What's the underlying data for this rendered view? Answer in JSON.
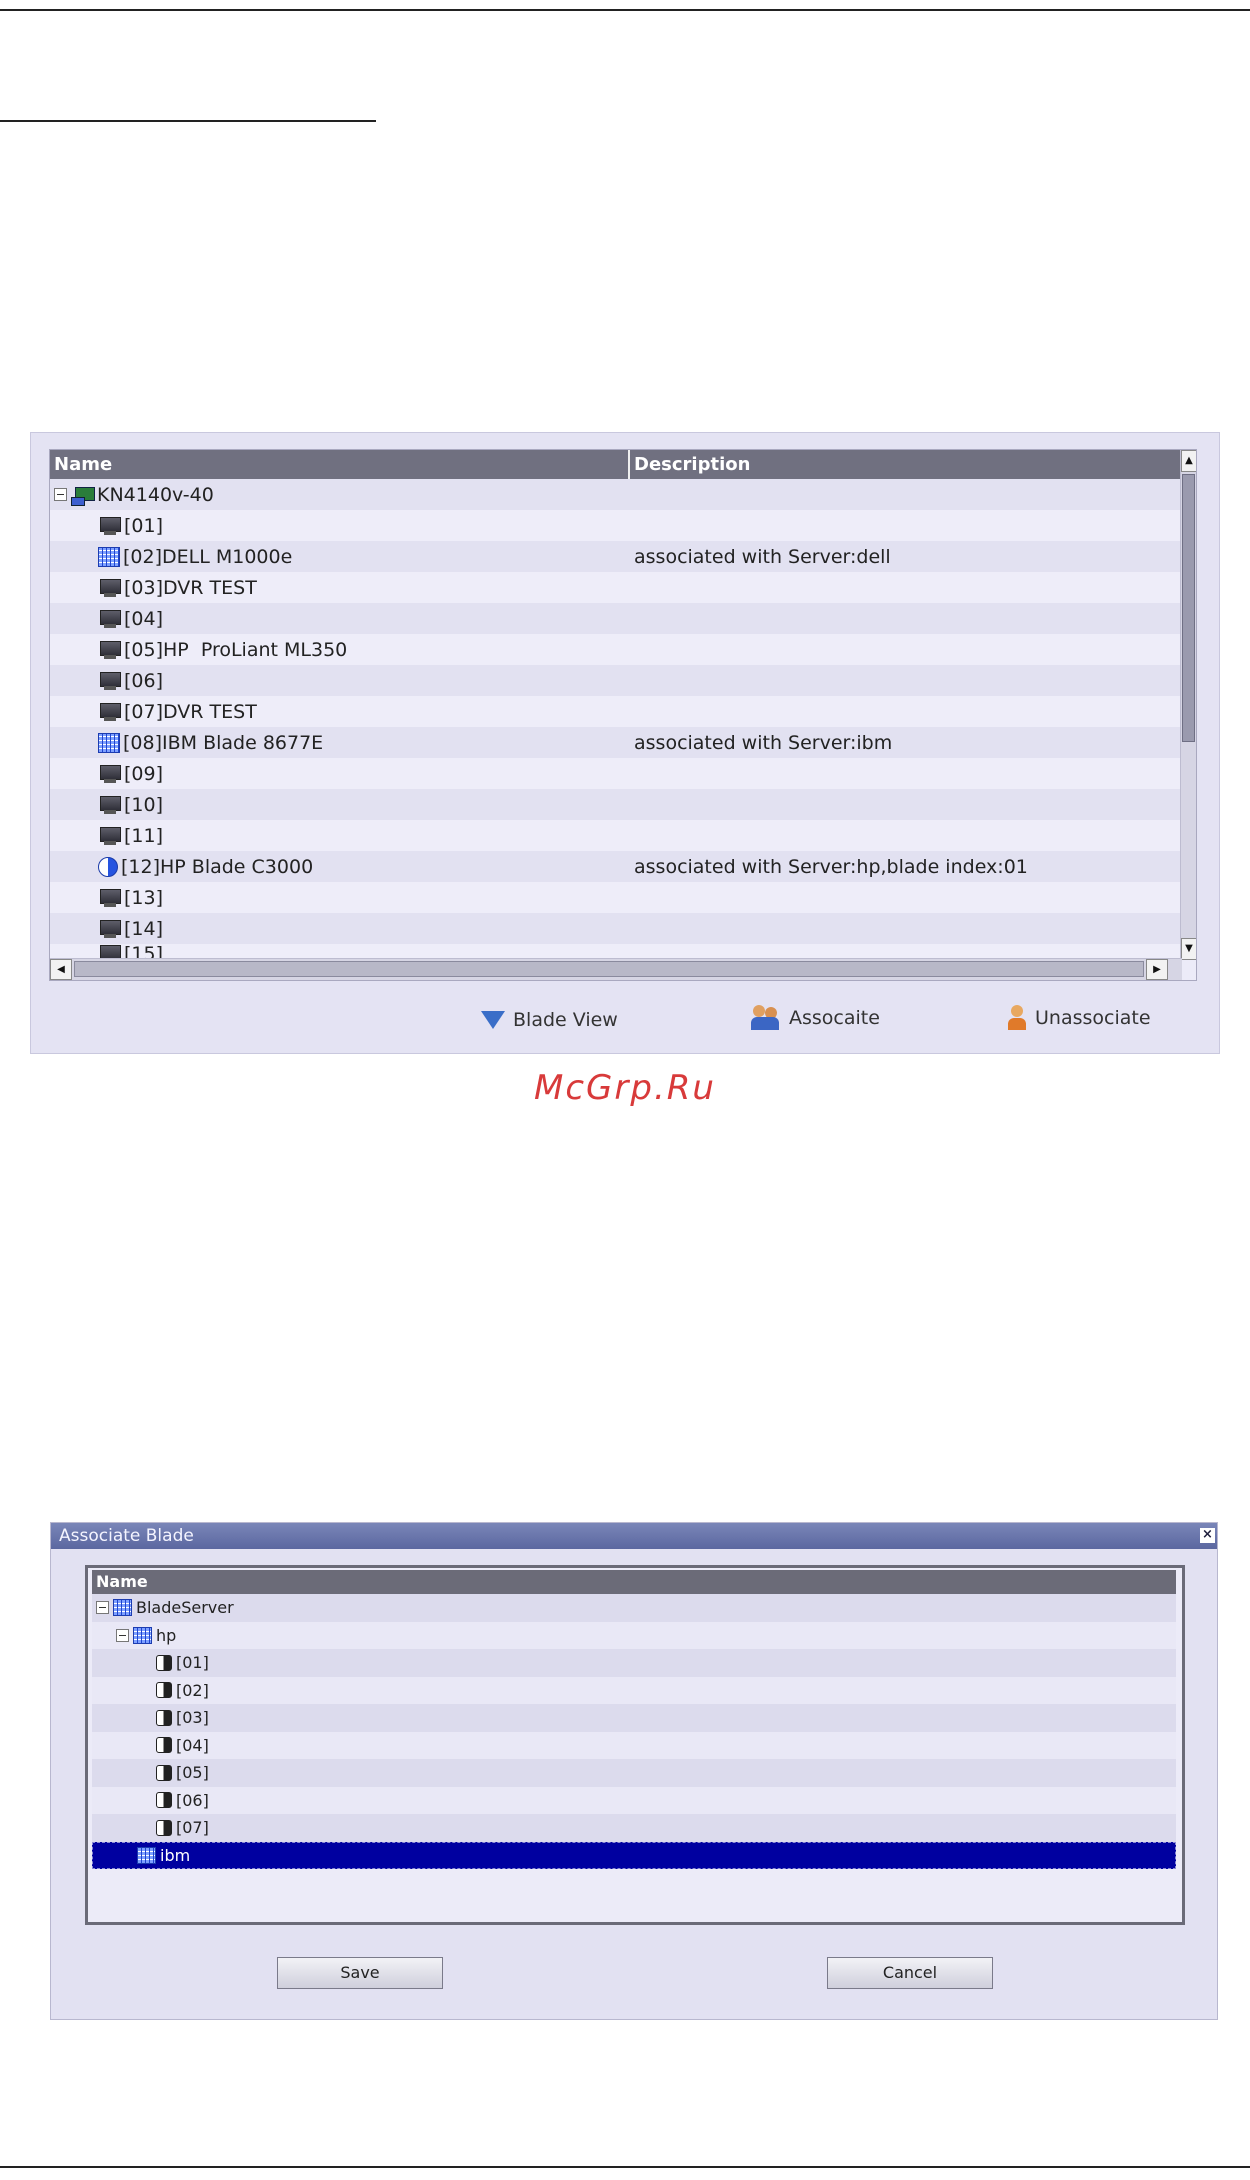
{
  "port_panel": {
    "columns": {
      "name": "Name",
      "description": "Description"
    },
    "root": {
      "label": "KN4140v-40"
    },
    "rows": [
      {
        "icon": "monitor-icon",
        "name": "[01]",
        "description": ""
      },
      {
        "icon": "blade-grid-icon",
        "name": "[02]DELL M1000e",
        "description": "associated with Server:dell"
      },
      {
        "icon": "monitor-icon",
        "name": "[03]DVR TEST",
        "description": ""
      },
      {
        "icon": "monitor-icon",
        "name": "[04]",
        "description": ""
      },
      {
        "icon": "monitor-icon",
        "name": "[05]HP  ProLiant ML350",
        "description": ""
      },
      {
        "icon": "monitor-icon",
        "name": "[06]",
        "description": ""
      },
      {
        "icon": "monitor-icon",
        "name": "[07]DVR TEST",
        "description": ""
      },
      {
        "icon": "blade-grid-icon",
        "name": "[08]IBM Blade 8677E",
        "description": "associated with Server:ibm"
      },
      {
        "icon": "monitor-icon",
        "name": "[09]",
        "description": ""
      },
      {
        "icon": "monitor-icon",
        "name": "[10]",
        "description": ""
      },
      {
        "icon": "monitor-icon",
        "name": "[11]",
        "description": ""
      },
      {
        "icon": "blade-half-icon",
        "name": "[12]HP Blade C3000",
        "description": "associated with Server:hp,blade index:01"
      },
      {
        "icon": "monitor-icon",
        "name": "[13]",
        "description": ""
      },
      {
        "icon": "monitor-icon",
        "name": "[14]",
        "description": ""
      },
      {
        "icon": "monitor-icon",
        "name": "[15]",
        "description": ""
      }
    ],
    "toolbar": {
      "blade_view": "Blade View",
      "associate": "Assocaite",
      "unassociate": "Unassociate"
    }
  },
  "watermark": "McGrp.Ru",
  "dialog": {
    "title": "Associate Blade",
    "close_glyph": "×",
    "column": "Name",
    "root": "BladeServer",
    "hp_node": "hp",
    "hp_children": [
      "[01]",
      "[02]",
      "[03]",
      "[04]",
      "[05]",
      "[06]",
      "[07]"
    ],
    "ibm_node": "ibm",
    "save": "Save",
    "cancel": "Cancel"
  }
}
